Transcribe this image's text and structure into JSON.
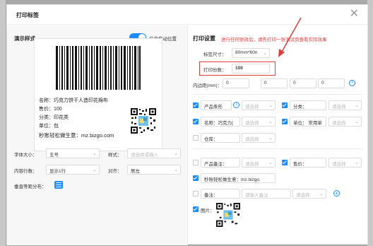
{
  "dialog": {
    "title": "打印标签"
  },
  "left": {
    "section_title": "演示样式",
    "drag_toggle_label": "任意拖动位置",
    "preview": {
      "lines": [
        "名称：巧克力饼干人造印花棉布",
        "售价：100",
        "分类：印花类",
        "单位：包",
        "秒账轻松做生意：mz.bizgo.com"
      ]
    },
    "font_size": {
      "label": "字体大小：",
      "value": "五号"
    },
    "style": {
      "label": "样式：",
      "placeholder": "请选择或输入"
    },
    "rows": {
      "label": "内容行数：",
      "value": "显示1行"
    },
    "align": {
      "label": "对齐：",
      "value": "居左"
    },
    "vertical": {
      "label": "垂直等距分布："
    }
  },
  "right": {
    "section_title": "打印设置",
    "notice": "进行任何修改后，请先打印一张测试页查看实际效果",
    "size": {
      "label": "标签尺寸：",
      "value": "80mm*60n"
    },
    "copies": {
      "label": "打印份数：",
      "value": "100"
    },
    "margin": {
      "label": "内边距(mm)：",
      "values": [
        "0",
        "0",
        "0",
        "0"
      ]
    },
    "fields": [
      {
        "name": "product-barcode",
        "label": "产品条形",
        "select": "请选择",
        "checked": true
      },
      {
        "name": "category",
        "label": "分类：",
        "select": "请选择",
        "checked": true
      },
      {
        "name": "name",
        "label": "名称：巧克力(",
        "select": "请选择",
        "checked": true
      },
      {
        "name": "unit",
        "label": "单位：",
        "unit_value": "常用单",
        "select": "请选择",
        "checked": true
      },
      {
        "name": "warehouse",
        "label": "仓库：",
        "select": "请选择",
        "checked": false
      },
      {
        "name": "product-note",
        "label": "产品备注：",
        "select": "请选择",
        "checked": false
      },
      {
        "name": "price",
        "label": "售价：",
        "select": "请选择",
        "checked": true
      },
      {
        "name": "slogan",
        "label": "秒账轻松做生意：mz.bizgo.",
        "checked": true
      },
      {
        "name": "note",
        "label": "备注：",
        "input_placeholder": "请输入备注",
        "select": "请选择",
        "checked": false
      },
      {
        "name": "image",
        "label": "图片：",
        "checked": true
      }
    ]
  }
}
